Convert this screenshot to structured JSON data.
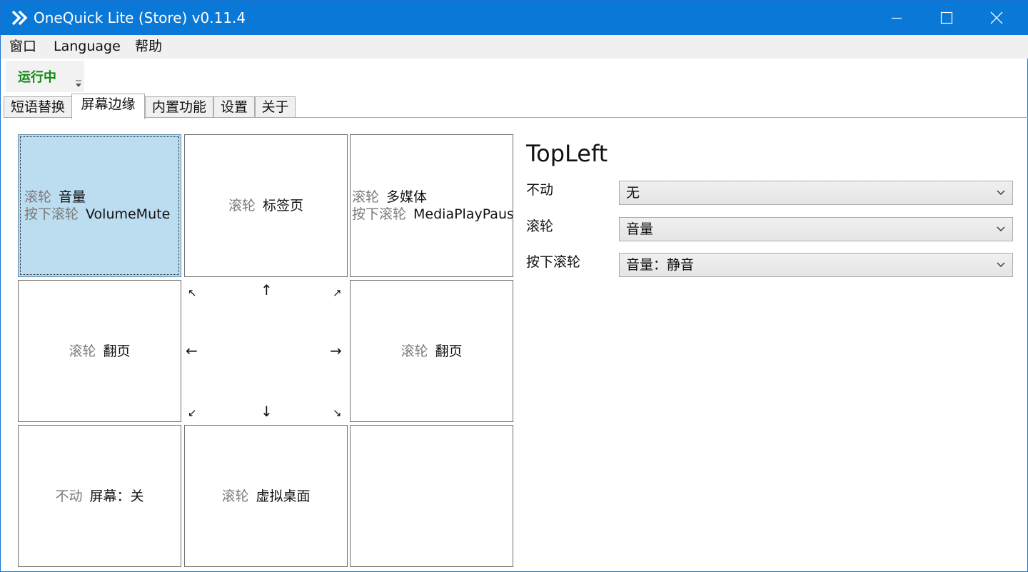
{
  "window": {
    "title": "OneQuick Lite (Store) v0.11.4",
    "accent_color": "#0a78d6"
  },
  "menu": [
    "窗口",
    "Language",
    "帮助"
  ],
  "status": {
    "label": "运行中",
    "color": "#138a13"
  },
  "tabs": [
    {
      "label": "短语替换",
      "active": false
    },
    {
      "label": "屏幕边缘",
      "active": true
    },
    {
      "label": "内置功能",
      "active": false
    },
    {
      "label": "设置",
      "active": false
    },
    {
      "label": "关于",
      "active": false
    }
  ],
  "grid": {
    "top_left": {
      "lines": [
        {
          "key": "滚轮",
          "value": "音量"
        },
        {
          "key": "按下滚轮",
          "value": "VolumeMute"
        }
      ],
      "selected": true
    },
    "top": {
      "lines": [
        {
          "key": "滚轮",
          "value": "标签页"
        }
      ]
    },
    "top_right": {
      "lines": [
        {
          "key": "滚轮",
          "value": "多媒体"
        },
        {
          "key": "按下滚轮",
          "value": "MediaPlayPause"
        }
      ]
    },
    "left": {
      "lines": [
        {
          "key": "滚轮",
          "value": "翻页"
        }
      ]
    },
    "right": {
      "lines": [
        {
          "key": "滚轮",
          "value": "翻页"
        }
      ]
    },
    "bottom_left": {
      "lines": [
        {
          "key": "不动",
          "value": "屏幕：关"
        }
      ]
    },
    "bottom": {
      "lines": [
        {
          "key": "滚轮",
          "value": "虚拟桌面"
        }
      ]
    },
    "bottom_right": {
      "lines": []
    },
    "arrows": {
      "up_left": "↖",
      "up": "↑",
      "up_right": "↗",
      "left": "←",
      "right": "→",
      "down_left": "↙",
      "down": "↓",
      "down_right": "↘"
    }
  },
  "detail": {
    "title": "TopLeft",
    "rows": [
      {
        "label": "不动",
        "value": "无"
      },
      {
        "label": "滚轮",
        "value": "音量"
      },
      {
        "label": "按下滚轮",
        "value": "音量：静音"
      }
    ]
  },
  "icons": {
    "app": "double-chevron-right-icon",
    "minimize": "minimize-icon",
    "maximize": "maximize-icon",
    "close": "close-icon",
    "status_dropdown": "dropdown-arrow-icon",
    "select": "chevron-down-icon"
  }
}
